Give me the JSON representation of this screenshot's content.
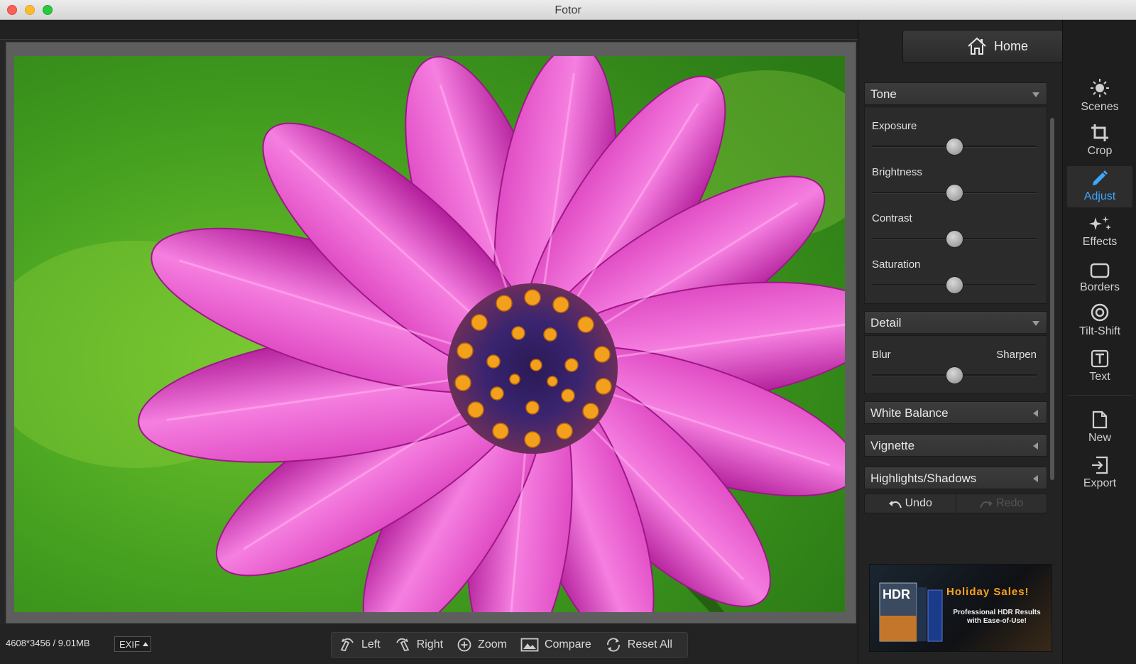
{
  "window": {
    "title": "Fotor"
  },
  "image_info": {
    "dimensions": "4608*3456 / 9.01MB",
    "exif_label": "EXIF"
  },
  "bottom_tools": [
    {
      "label": "Left",
      "icon": "rotate-left-icon"
    },
    {
      "label": "Right",
      "icon": "rotate-right-icon"
    },
    {
      "label": "Zoom",
      "icon": "zoom-icon"
    },
    {
      "label": "Compare",
      "icon": "compare-icon"
    },
    {
      "label": "Reset All",
      "icon": "reset-icon"
    }
  ],
  "panel": {
    "home_label": "Home",
    "tone": {
      "title": "Tone",
      "sliders": [
        {
          "label": "Exposure",
          "value": 0.5
        },
        {
          "label": "Brightness",
          "value": 0.5
        },
        {
          "label": "Contrast",
          "value": 0.5
        },
        {
          "label": "Saturation",
          "value": 0.5
        }
      ]
    },
    "detail": {
      "title": "Detail",
      "left_label": "Blur",
      "right_label": "Sharpen",
      "value": 0.5
    },
    "collapsed_sections": [
      "White Balance",
      "Vignette",
      "Highlights/Shadows"
    ],
    "undo_label": "Undo",
    "redo_label": "Redo"
  },
  "ad": {
    "title": "Holiday Sales!",
    "line1": "Professional HDR Results",
    "line2": "with Ease-of-Use!",
    "box_text": "HDR"
  },
  "tools": [
    {
      "label": "Scenes",
      "icon": "sun-icon",
      "active": false
    },
    {
      "label": "Crop",
      "icon": "crop-icon",
      "active": false
    },
    {
      "label": "Adjust",
      "icon": "pencil-icon",
      "active": true
    },
    {
      "label": "Effects",
      "icon": "sparkles-icon",
      "active": false
    },
    {
      "label": "Borders",
      "icon": "border-icon",
      "active": false
    },
    {
      "label": "Tilt-Shift",
      "icon": "tilt-shift-icon",
      "active": false
    },
    {
      "label": "Text",
      "icon": "text-icon",
      "active": false
    }
  ],
  "file_tools": [
    {
      "label": "New",
      "icon": "new-file-icon"
    },
    {
      "label": "Export",
      "icon": "export-icon"
    }
  ],
  "colors": {
    "accent": "#3fa6ff",
    "ad_title": "#ffa41a"
  }
}
